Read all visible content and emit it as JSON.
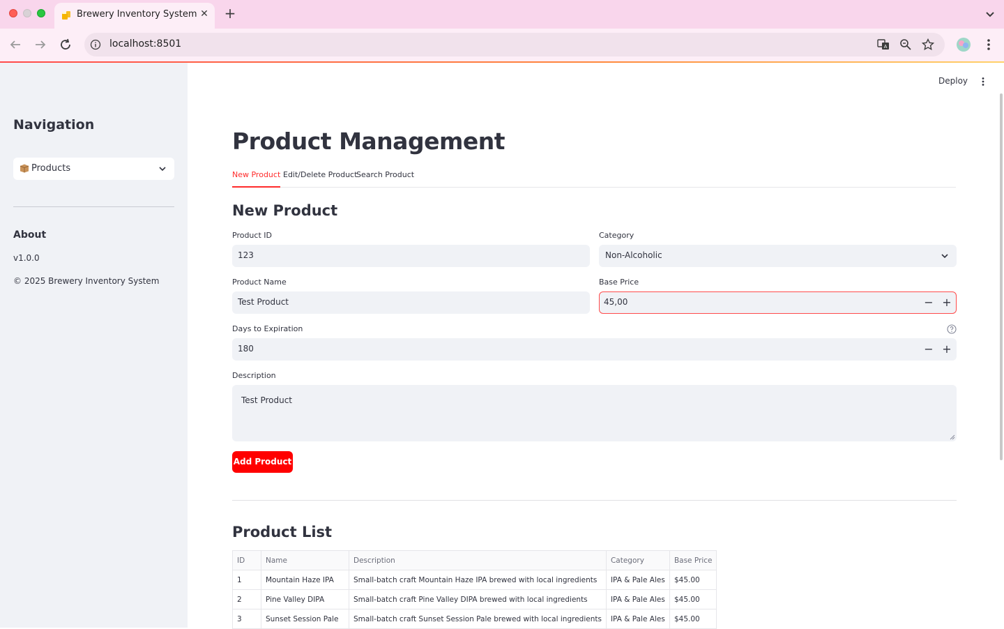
{
  "browser": {
    "tab_title": "Brewery Inventory System",
    "url": "localhost:8501"
  },
  "sidebar": {
    "nav_title": "Navigation",
    "nav_selected": "Products",
    "about_title": "About",
    "version": "v1.0.0",
    "copyright": "© 2025 Brewery Inventory System"
  },
  "header": {
    "deploy_label": "Deploy"
  },
  "page": {
    "title": "Product Management",
    "tabs": [
      {
        "label": "New Product",
        "active": true
      },
      {
        "label": "Edit/Delete Product",
        "active": false
      },
      {
        "label": "Search Product",
        "active": false
      }
    ]
  },
  "form": {
    "section_title": "New Product",
    "product_id_label": "Product ID",
    "product_id_value": "123",
    "category_label": "Category",
    "category_value": "Non-Alcoholic",
    "product_name_label": "Product Name",
    "product_name_value": "Test Product",
    "base_price_label": "Base Price",
    "base_price_value": "45,00",
    "days_label": "Days to Expiration",
    "days_value": "180",
    "description_label": "Description",
    "description_value": "Test Product",
    "submit_label": "Add Product"
  },
  "product_list": {
    "title": "Product List",
    "columns": [
      "ID",
      "Name",
      "Description",
      "Category",
      "Base Price"
    ],
    "rows": [
      [
        "1",
        "Mountain Haze IPA",
        "Small-batch craft Mountain Haze IPA brewed with local ingredients",
        "IPA & Pale Ales",
        "$45.00"
      ],
      [
        "2",
        "Pine Valley DIPA",
        "Small-batch craft Pine Valley DIPA brewed with local ingredients",
        "IPA & Pale Ales",
        "$45.00"
      ],
      [
        "3",
        "Sunset Session Pale",
        "Small-batch craft Sunset Session Pale brewed with local ingredients",
        "IPA & Pale Ales",
        "$45.00"
      ]
    ]
  },
  "colors": {
    "accent": "#ff4b4b",
    "primary_button": "#ff0000",
    "sidebar_bg": "#f0f2f6",
    "chrome_bg": "#f9d6ec"
  }
}
